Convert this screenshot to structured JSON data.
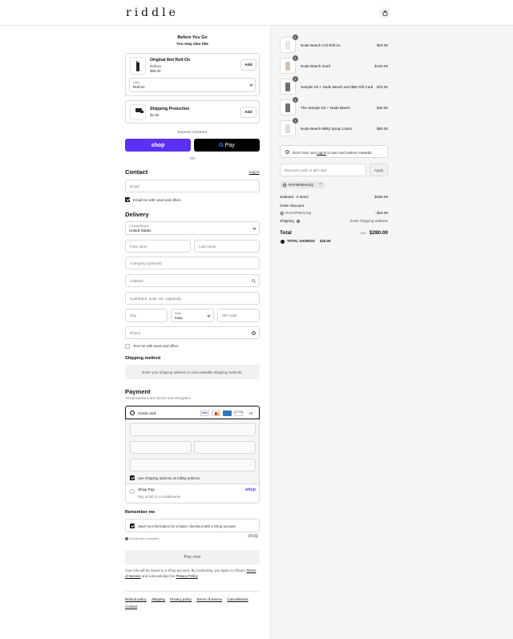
{
  "header": {
    "logo": "riddle"
  },
  "upsell": {
    "heading": "Before You Go",
    "subheading": "You may also like",
    "product1": {
      "name": "Original 8ml Roll-On",
      "variant": "Roll-on",
      "price": "$58.00",
      "add": "Add",
      "style_label": "Style",
      "style_value": "Roll-on"
    },
    "product2": {
      "name": "Shipping Protection",
      "price": "$2.98",
      "add": "Add"
    }
  },
  "express": {
    "label": "Express checkout",
    "shop_pay": "shop",
    "gpay": "Pay",
    "or": "OR"
  },
  "contact": {
    "heading": "Contact",
    "login": "Log in",
    "email_placeholder": "Email",
    "news_label": "Email me with news and offers"
  },
  "delivery": {
    "heading": "Delivery",
    "country_label": "Country/Region",
    "country_value": "United States",
    "first_name": "First name",
    "last_name": "Last name",
    "company": "Company (optional)",
    "address": "Address",
    "apartment": "Apartment, suite, etc. (optional)",
    "city": "City",
    "state_label": "State",
    "state_value": "Iowa",
    "zip": "ZIP code",
    "phone": "Phone",
    "text_label": "Text me with news and offers"
  },
  "shipping_method": {
    "heading": "Shipping method",
    "notice": "Enter your shipping address to view available shipping methods."
  },
  "payment": {
    "heading": "Payment",
    "subtitle": "All transactions are secure and encrypted.",
    "credit_card": "Credit card",
    "cards": [
      "VISA",
      "MC",
      "AMEX",
      "DISCOVER"
    ],
    "more": "+3",
    "billing_label": "Use shipping address as billing address",
    "shop_pay_title": "Shop Pay",
    "shop_pay_sub": "Pay in full or in installments",
    "shop_pay_logo": "shop"
  },
  "remember": {
    "heading": "Remember me",
    "save_label": "Save my information for a faster checkout with a Shop account",
    "secure": "Secure and encrypted",
    "shop_logo": "shop"
  },
  "pay_now": "Pay now",
  "legal": {
    "text1": "Your info will be saved to a Shop account. By continuing, you agree to Shop's",
    "terms": "Terms of Service",
    "text2": "and acknowledge the",
    "privacy": "Privacy Policy",
    "period": "."
  },
  "footer": {
    "links": [
      "Refund policy",
      "Shipping",
      "Privacy policy",
      "Terms of service",
      "Cancellations",
      "Contact"
    ]
  },
  "order": {
    "items": [
      {
        "name": "Nude Beach 1ml Roll-on",
        "price": "$10.00",
        "qty": "1"
      },
      {
        "name": "Nude Beach Scarf",
        "price": "$120.00",
        "qty": "1"
      },
      {
        "name": "Sample Kit + Nude Beach and $50 Gift Card",
        "price": "$70.00",
        "qty": "1"
      },
      {
        "name": "The Sample Kit + Nude Beach",
        "price": "$40.00",
        "qty": "1"
      },
      {
        "name": "Nude Beach Milky Spray Lotion",
        "price": "$50.00",
        "qty": "1"
      }
    ],
    "rewards_text1": "Don't miss out!",
    "rewards_login": "Log in",
    "rewards_text2": "to earn and redeem rewards",
    "discount_placeholder": "Discount code or gift card",
    "apply": "Apply",
    "code": "RAFNPIDAV1Q",
    "subtotal_label": "Subtotal · 5 items",
    "subtotal_value": "$290.00",
    "order_discount_label": "Order discount",
    "discount_code": "RAFNPIDAV1Q",
    "discount_value": "- $10.00",
    "shipping_label": "Shipping",
    "shipping_value": "Enter shipping address",
    "total_label": "Total",
    "currency": "USD",
    "total_value": "$280.00",
    "savings_label": "TOTAL SAVINGS",
    "savings_value": "$10.00"
  }
}
